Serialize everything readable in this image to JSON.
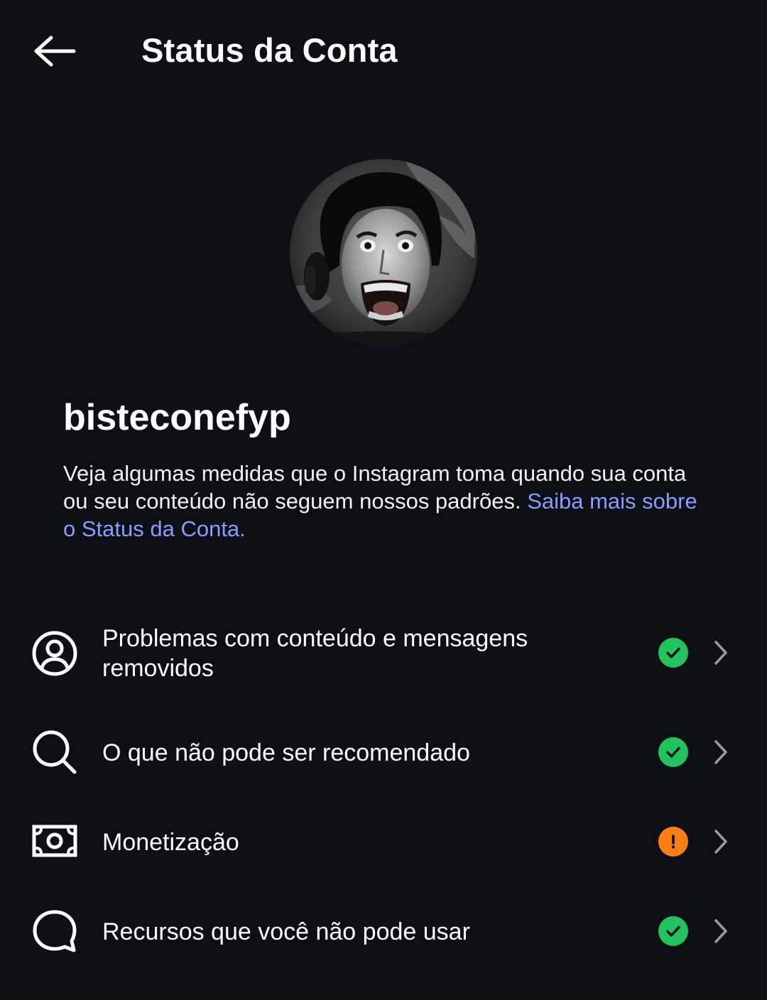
{
  "header": {
    "title": "Status da Conta",
    "back_icon": "arrow-left-icon"
  },
  "profile": {
    "username": "bisteconefyp",
    "description_text": "Veja algumas medidas que o Instagram toma quando sua conta ou seu conteúdo não seguem nossos padrões. ",
    "learn_more_link": "Saiba mais sobre o Status da Conta."
  },
  "items": [
    {
      "label": "Problemas com conteúdo e mensagens removidos",
      "icon": "user-circle-icon",
      "status": "ok",
      "status_icon": "check-circle-icon"
    },
    {
      "label": "O que não pode ser recomendado",
      "icon": "search-icon",
      "status": "ok",
      "status_icon": "check-circle-icon"
    },
    {
      "label": "Monetização",
      "icon": "money-icon",
      "status": "warning",
      "status_icon": "exclamation-circle-icon"
    },
    {
      "label": "Recursos que você não pode usar",
      "icon": "chat-bubble-icon",
      "status": "ok",
      "status_icon": "check-circle-icon"
    }
  ],
  "colors": {
    "background": "#0c0f14",
    "link": "#8c9bff",
    "status_ok": "#22c35e",
    "status_warning": "#fb7e14"
  }
}
